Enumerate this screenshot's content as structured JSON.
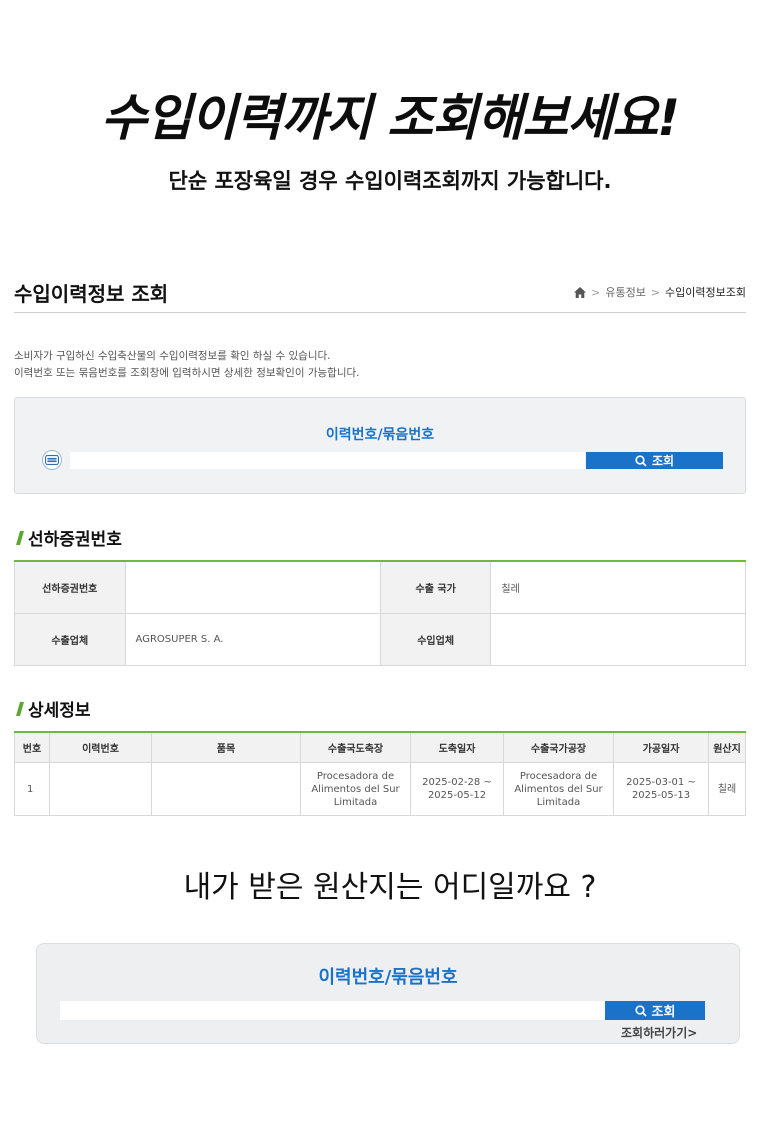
{
  "hero": {
    "headline": "수입이력까지 조회해보세요!",
    "subline": "단순 포장육일 경우 수입이력조회까지 가능합니다."
  },
  "page": {
    "title": "수입이력정보 조회",
    "breadcrumb": [
      "유통정보",
      "수입이력정보조회"
    ],
    "description": [
      "소비자가 구입하신 수입축산물의 수입이력정보를 확인 하실 수 있습니다.",
      "이력번호 또는 묶음번호를 조회창에 입력하시면 상세한 정보확인이 가능합니다."
    ]
  },
  "search": {
    "label": "이력번호/묶음번호",
    "value": "",
    "button": "조회"
  },
  "bl_section": {
    "title": "선하증권번호",
    "rows": [
      [
        {
          "label": "선하증권번호",
          "value": ""
        },
        {
          "label": "수출 국가",
          "value": "칠레"
        }
      ],
      [
        {
          "label": "수출업체",
          "value": "AGROSUPER S. A."
        },
        {
          "label": "수입업체",
          "value": ""
        }
      ]
    ]
  },
  "detail_section": {
    "title": "상세정보",
    "columns": [
      "번호",
      "이력번호",
      "품목",
      "수출국도축장",
      "도축일자",
      "수출국가공장",
      "가공일자",
      "원산지"
    ],
    "rows": [
      {
        "no": "1",
        "trace_no": "",
        "item": "",
        "slaughterhouse": [
          "Procesadora de",
          "Alimentos del Sur",
          "Limitada"
        ],
        "slaughter_date": [
          "2025-02-28 ~",
          "2025-05-12"
        ],
        "factory": [
          "Procesadora de",
          "Alimentos del Sur",
          "Limitada"
        ],
        "process_date": [
          "2025-03-01 ~",
          "2025-05-13"
        ],
        "origin": "칠레"
      }
    ]
  },
  "bottom": {
    "question": "내가 받은 원산지는 어디일까요 ?",
    "label": "이력번호/묶음번호",
    "button": "조회",
    "link": "조회하러가기>"
  },
  "colors": {
    "accent_blue": "#1a73c9",
    "table_green": "#70b83f"
  },
  "icons": [
    "home-icon",
    "search-icon",
    "green-slash-icon",
    "trace-mark-icon"
  ]
}
